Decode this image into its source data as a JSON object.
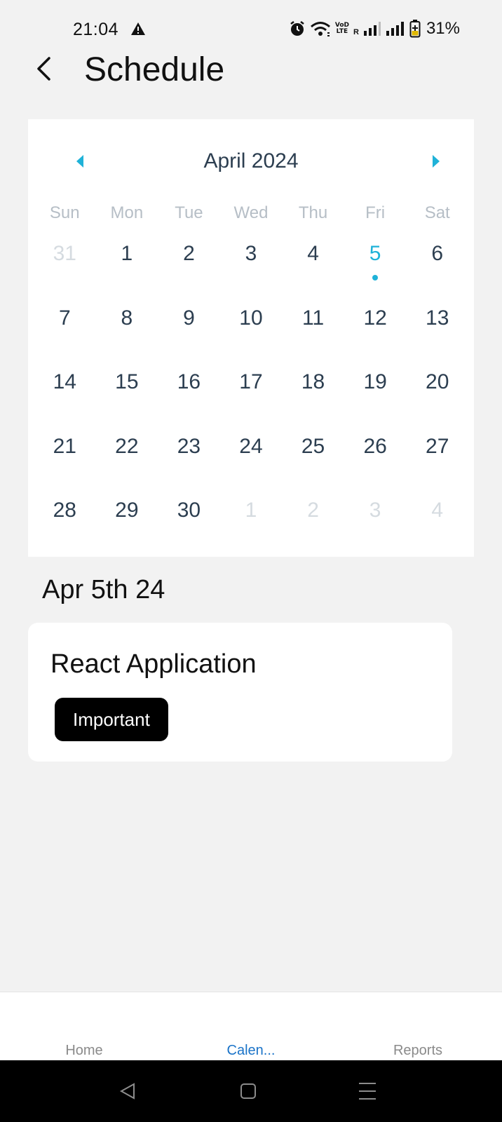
{
  "status_bar": {
    "time": "21:04",
    "lte_top": "VoD",
    "lte_bottom": "LTE",
    "roaming": "R",
    "battery_percent": "31%"
  },
  "header": {
    "title": "Schedule"
  },
  "calendar": {
    "month_label": "April 2024",
    "weekdays": [
      "Sun",
      "Mon",
      "Tue",
      "Wed",
      "Thu",
      "Fri",
      "Sat"
    ],
    "weeks": [
      [
        "31",
        "1",
        "2",
        "3",
        "4",
        "5",
        "6"
      ],
      [
        "7",
        "8",
        "9",
        "10",
        "11",
        "12",
        "13"
      ],
      [
        "14",
        "15",
        "16",
        "17",
        "18",
        "19",
        "20"
      ],
      [
        "21",
        "22",
        "23",
        "24",
        "25",
        "26",
        "27"
      ],
      [
        "28",
        "29",
        "30",
        "1",
        "2",
        "3",
        "4"
      ]
    ],
    "selected_day": "5",
    "accent_color": "#1fb2d8"
  },
  "selected_date": {
    "label": "Apr 5th 24"
  },
  "event": {
    "title": "React Application",
    "tag": "Important"
  },
  "tabs": [
    {
      "label": "Home",
      "active": false
    },
    {
      "label": "Calen...",
      "active": true
    },
    {
      "label": "Reports",
      "active": false
    }
  ],
  "colors": {
    "background": "#f2f2f2",
    "active_tab": "#1a73c8"
  }
}
